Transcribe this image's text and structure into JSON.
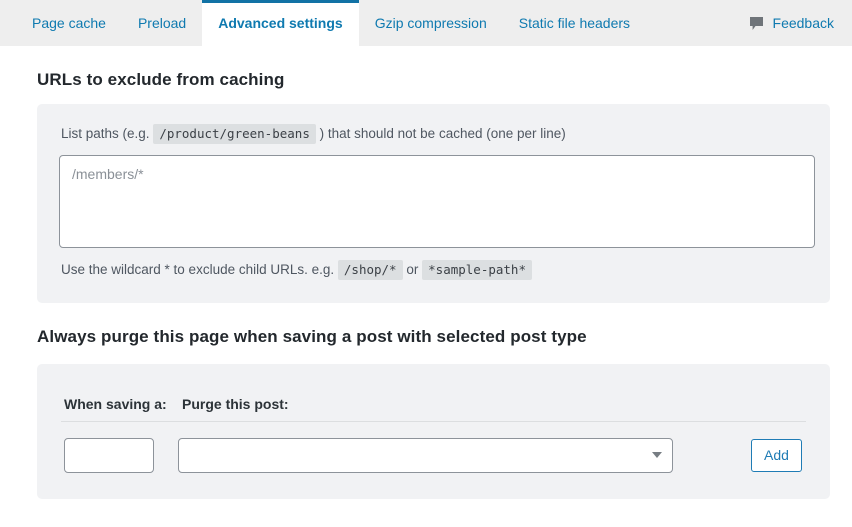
{
  "tabs": [
    {
      "label": "Page cache",
      "active": false
    },
    {
      "label": "Preload",
      "active": false
    },
    {
      "label": "Advanced settings",
      "active": true
    },
    {
      "label": "Gzip compression",
      "active": false
    },
    {
      "label": "Static file headers",
      "active": false
    }
  ],
  "feedback": {
    "label": "Feedback",
    "icon": "comment-bubble-icon"
  },
  "exclude_section": {
    "title": "URLs to exclude from caching",
    "hint_before_code": "List paths (e.g.",
    "hint_code": "/product/green-beans",
    "hint_after_code": ") that should not be cached (one per line)",
    "textarea_placeholder": "/members/*",
    "textarea_value": "",
    "footnote_before": "Use the wildcard * to exclude child URLs. e.g.",
    "footnote_code_1": "/shop/*",
    "footnote_between": "or",
    "footnote_code_2": "*sample-path*"
  },
  "purge_section": {
    "title": "Always purge this page when saving a post with selected post type",
    "label_when_saving": "When saving a:",
    "label_purge_post": "Purge this post:",
    "small_input_value": "",
    "select_value": "",
    "select_options": [
      ""
    ],
    "add_button_label": "Add"
  },
  "colors": {
    "accent_blue": "#0f7ab0",
    "active_tab_border": "#1272a5",
    "tabbar_bg": "#eeeeee",
    "panel_bg": "#f1f2f4",
    "code_bg": "#dcdfe1",
    "button_blue": "#1f7cb5"
  }
}
